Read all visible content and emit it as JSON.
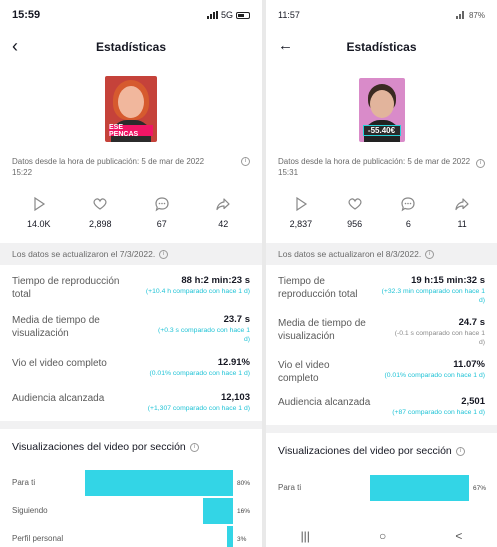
{
  "colors": {
    "accent_bar": "#33d5e6",
    "compare_text": "#20c3d6",
    "thumb_caption": "#f01565"
  },
  "left": {
    "status_time": "15:59",
    "status_right": "5G",
    "title": "Estadísticas",
    "back_icon": "chevron-left-icon",
    "thumb_caption": "ESE PENCAS",
    "since": "Datos desde la hora de publicación: 5 de mar de 2022 15:22",
    "info_icon": "i",
    "stats": [
      {
        "icon": "play-icon",
        "value": "14.0K"
      },
      {
        "icon": "heart-icon",
        "value": "2,898"
      },
      {
        "icon": "comment-icon",
        "value": "67"
      },
      {
        "icon": "share-icon",
        "value": "42"
      }
    ],
    "updated": "Los datos se actualizaron el 7/3/2022.",
    "metrics": [
      {
        "label": "Tiempo de reproducción total",
        "value": "88 h:2 min:23 s",
        "compare": "(+10.4 h comparado con hace 1 d)"
      },
      {
        "label": "Media de tiempo de visualización",
        "value": "23.7 s",
        "compare": "(+0.3 s comparado con hace 1 d)"
      },
      {
        "label": "Vio el video completo",
        "value": "12.91%",
        "compare": "(0.01% comparado con hace 1 d)"
      },
      {
        "label": "Audiencia alcanzada",
        "value": "12,103",
        "compare": "(+1,307 comparado con hace 1 d)"
      }
    ],
    "section_title": "Visualizaciones del video por sección",
    "sections": [
      {
        "label": "Para ti",
        "percent": 80,
        "pct_label": "80%"
      },
      {
        "label": "Siguiendo",
        "percent": 16,
        "pct_label": "16%"
      },
      {
        "label": "Perfil personal",
        "percent": 3,
        "pct_label": "3%"
      }
    ]
  },
  "right": {
    "status_time": "11:57",
    "status_right": "87%",
    "title": "Estadísticas",
    "back_icon": "arrow-left-icon",
    "thumb_caption": "-55.40€",
    "since": "Datos desde la hora de publicación: 5 de mar de 2022 15:31",
    "info_icon": "i",
    "stats": [
      {
        "icon": "play-icon",
        "value": "2,837"
      },
      {
        "icon": "heart-icon",
        "value": "956"
      },
      {
        "icon": "comment-icon",
        "value": "6"
      },
      {
        "icon": "share-icon",
        "value": "11"
      }
    ],
    "updated": "Los datos se actualizaron el 8/3/2022.",
    "metrics": [
      {
        "label": "Tiempo de reproducción total",
        "value": "19 h:15 min:32 s",
        "compare": "(+32.3 min comparado con hace 1 d)"
      },
      {
        "label": "Media de tiempo de visualización",
        "value": "24.7 s",
        "compare": "(-0.1 s comparado con hace 1 d)"
      },
      {
        "label": "Vio el video completo",
        "value": "11.07%",
        "compare": "(0.01% comparado con hace 1 d)"
      },
      {
        "label": "Audiencia alcanzada",
        "value": "2,501",
        "compare": "(+87 comparado con hace 1 d)"
      }
    ],
    "section_title": "Visualizaciones del video por sección",
    "sections": [
      {
        "label": "Para ti",
        "percent": 67,
        "pct_label": "67%"
      }
    ],
    "nav": [
      "|||",
      "○",
      "<"
    ]
  }
}
